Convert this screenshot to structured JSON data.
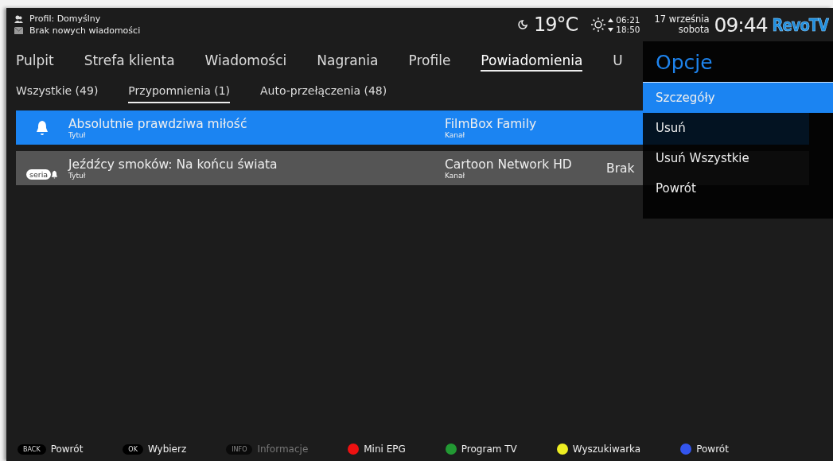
{
  "header": {
    "profile": "Profil: Domyślny",
    "messages": "Brak nowych wiadomości",
    "temperature": "19°C",
    "sunrise": "06:21",
    "sunset": "18:50",
    "date": "17 września",
    "weekday": "sobota",
    "time": "09:44",
    "logo": "RevoTV"
  },
  "nav": [
    {
      "label": "Pulpit",
      "selected": false
    },
    {
      "label": "Strefa klienta",
      "selected": false
    },
    {
      "label": "Wiadomości",
      "selected": false
    },
    {
      "label": "Nagrania",
      "selected": false
    },
    {
      "label": "Profile",
      "selected": false
    },
    {
      "label": "Powiadomienia",
      "selected": true
    },
    {
      "label": "U",
      "selected": false
    }
  ],
  "subtabs": [
    {
      "label": "Wszystkie (49)",
      "selected": false
    },
    {
      "label": "Przypomnienia (1)",
      "selected": true
    },
    {
      "label": "Auto-przełączenia (48)",
      "selected": false
    }
  ],
  "rows": [
    {
      "kind": "bell",
      "selected": true,
      "title": "Absolutnie prawdziwa miłość",
      "title_label": "Tytuł",
      "channel": "FilmBox Family",
      "channel_label": "Kanał"
    },
    {
      "kind": "series",
      "badge": "seria",
      "selected": false,
      "title": "Jeźdźcy smoków: Na końcu świata",
      "title_label": "Tytuł",
      "channel": "Cartoon Network HD",
      "channel_label": "Kanał",
      "info": "Brak"
    }
  ],
  "menu": {
    "title": "Opcje",
    "items": [
      {
        "label": "Szczegóły",
        "selected": true
      },
      {
        "label": "Usuń",
        "selected": false
      },
      {
        "label": "Usuń Wszystkie",
        "selected": false
      },
      {
        "label": "Powrót",
        "selected": false
      }
    ]
  },
  "footer": [
    {
      "kind": "key",
      "key": "BACK",
      "label": "Powrót",
      "disabled": false
    },
    {
      "kind": "key",
      "key": "OK",
      "label": "Wybierz",
      "disabled": false
    },
    {
      "kind": "key",
      "key": "INFO",
      "label": "Informacje",
      "disabled": true
    },
    {
      "kind": "color",
      "color": "#ee1111",
      "label": "Mini EPG"
    },
    {
      "kind": "color",
      "color": "#229933",
      "label": "Program TV"
    },
    {
      "kind": "color",
      "color": "#eeee22",
      "label": "Wyszukiwarka"
    },
    {
      "kind": "color",
      "color": "#3355ee",
      "label": "Powrót"
    }
  ]
}
